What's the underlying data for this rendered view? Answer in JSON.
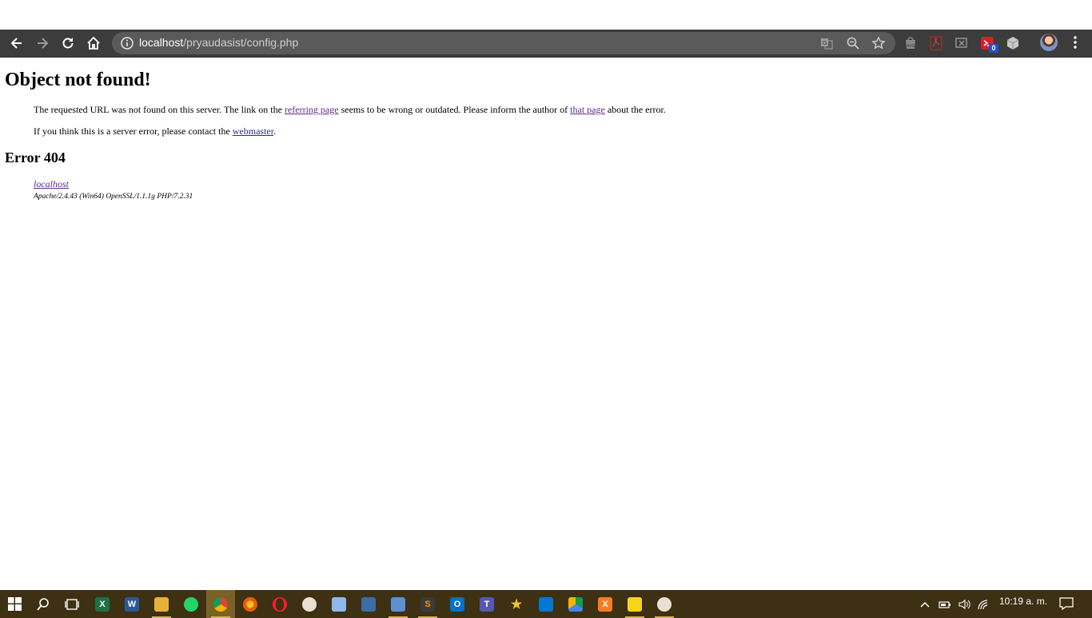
{
  "browser": {
    "url_host": "localhost",
    "url_path": "/pryaudasist/config.php"
  },
  "page": {
    "title": "Object not found!",
    "para1_pre": "The requested URL was not found on this server. The link on the ",
    "para1_link1": "referring page",
    "para1_mid": " seems to be wrong or outdated. Please inform the author of ",
    "para1_link2": "that page",
    "para1_post": " about the error.",
    "para2_pre": "If you think this is a server error, please contact the ",
    "para2_link": "webmaster",
    "para2_post": ".",
    "error_heading": "Error 404",
    "address_link": "localhost",
    "server_info": "Apache/2.4.43 (Win64) OpenSSL/1.1.1g PHP/7.2.31"
  },
  "extensions": {
    "badge_count": "0"
  },
  "taskbar": {
    "clock": "10:19 a. m."
  },
  "colors": {
    "toolbar": "#3c3c3c",
    "omnibox": "#5a5a5a",
    "taskbar": "#3d3013",
    "link": "#2c2d8a",
    "visited_link": "#5a2b86"
  }
}
